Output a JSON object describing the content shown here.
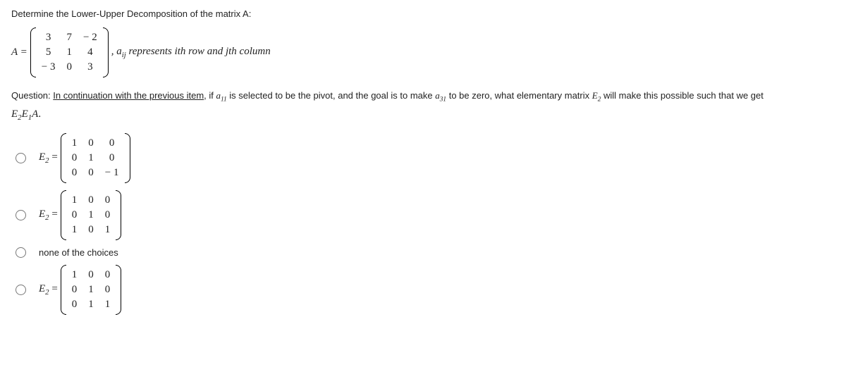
{
  "prompt": "Determine the Lower-Upper Decomposition of the matrix A:",
  "matrixA": {
    "lhs": "A =",
    "rows": [
      [
        "3",
        "7",
        "− 2"
      ],
      [
        "5",
        "1",
        "4"
      ],
      [
        "− 3",
        "0",
        "3"
      ]
    ],
    "note_prefix": ", ",
    "note_var": "a",
    "note_sub": "ij",
    "note_text": " represents ith row and jth column"
  },
  "question": {
    "p1": "Question: ",
    "p2": "In continuation with the previous item",
    "p3": ", if ",
    "a11_a": "a",
    "a11_s": "11",
    "p4": " is selected to be the pivot, and the goal is to make ",
    "a31_a": "a",
    "a31_s": "31",
    "p5": " to be zero, what elementary matrix ",
    "e2_a": "E",
    "e2_s": "2",
    "p6": " will make this possible such that we get"
  },
  "result": {
    "e2": "E",
    "s2": "2",
    "e1": "E",
    "s1": "1",
    "A": "A",
    "dot": "."
  },
  "options": [
    {
      "type": "matrix",
      "label_E": "E",
      "label_sub": "2",
      "eq": " = ",
      "rows": [
        [
          "1",
          "0",
          "0"
        ],
        [
          "0",
          "1",
          "0"
        ],
        [
          "0",
          "0",
          "− 1"
        ]
      ]
    },
    {
      "type": "matrix",
      "label_E": "E",
      "label_sub": "2",
      "eq": " = ",
      "rows": [
        [
          "1",
          "0",
          "0"
        ],
        [
          "0",
          "1",
          "0"
        ],
        [
          "1",
          "0",
          "1"
        ]
      ]
    },
    {
      "type": "text",
      "text": "none of the choices"
    },
    {
      "type": "matrix",
      "label_E": "E",
      "label_sub": "2",
      "eq": " = ",
      "rows": [
        [
          "1",
          "0",
          "0"
        ],
        [
          "0",
          "1",
          "0"
        ],
        [
          "0",
          "1",
          "1"
        ]
      ]
    }
  ]
}
